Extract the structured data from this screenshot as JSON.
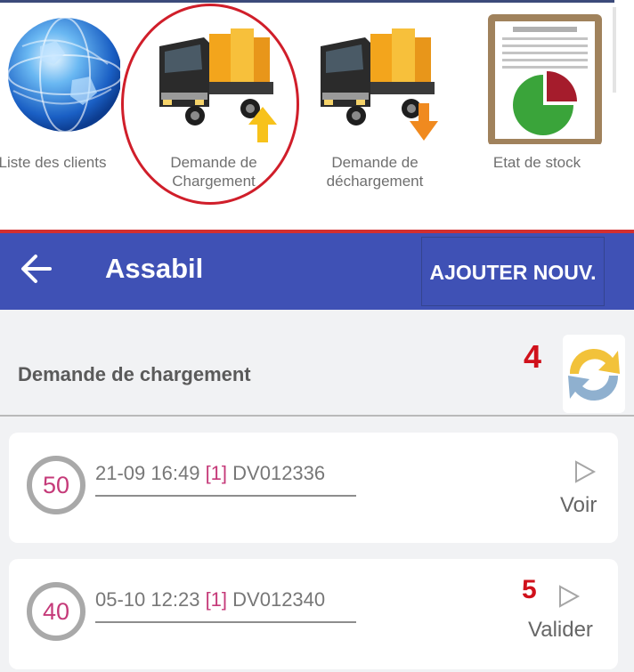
{
  "launcher": {
    "tiles": [
      {
        "label": "Liste des clients",
        "icon": "globe-icon"
      },
      {
        "label": "Demande de Chargement",
        "icon": "truck-loading-icon"
      },
      {
        "label": "Demande de déchargement",
        "icon": "truck-unloading-icon"
      },
      {
        "label": "Etat de stock",
        "icon": "stock-report-icon"
      }
    ]
  },
  "appbar": {
    "title": "Assabil",
    "add_label": "AJOUTER NOUV.",
    "color": "#3f51b5"
  },
  "section": {
    "title": "Demande de chargement"
  },
  "annotations": {
    "refresh_marker": "4",
    "validate_marker": "5",
    "color": "#d0111b"
  },
  "requests": [
    {
      "badge": "50",
      "date": "21-09 16:49",
      "qty": "[1]",
      "ref": "DV012336",
      "action": "Voir"
    },
    {
      "badge": "40",
      "date": "05-10 12:23",
      "qty": "[1]",
      "ref": "DV012340",
      "action": "Valider"
    }
  ]
}
